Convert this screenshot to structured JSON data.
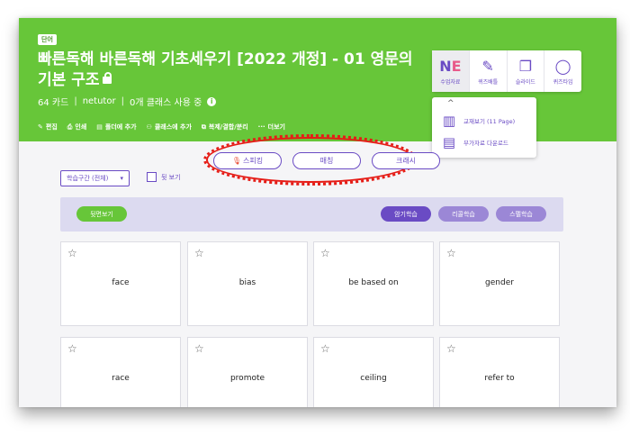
{
  "header": {
    "tag": "단어",
    "title": "빠른독해 바른독해 기초세우기 [2022 개정] - 01 영문의 기본 구조",
    "card_count": "64 카드",
    "author": "netutor",
    "class_usage": "0개 클래스 사용 중",
    "separator": "|"
  },
  "tools": [
    {
      "icon": "✎",
      "label": "편집"
    },
    {
      "icon": "⎙",
      "label": "인쇄"
    },
    {
      "icon": "▤",
      "label": "폴더에 추가"
    },
    {
      "icon": "⚇",
      "label": "클래스에 추가"
    },
    {
      "icon": "⧉",
      "label": "복제/결합/분리"
    },
    {
      "icon": "···",
      "label": "더보기"
    }
  ],
  "modes": [
    {
      "label": "수업자료",
      "icon": "nf-logo"
    },
    {
      "label": "퀴즈배틀",
      "icon": "pen-icon"
    },
    {
      "label": "슬라이드",
      "icon": "slides-icon"
    },
    {
      "label": "퀴즈타임",
      "icon": "quiz-icon"
    }
  ],
  "dropdown": {
    "items": [
      {
        "label": "교재보기 (11 Page)",
        "icon": "book-icon"
      },
      {
        "label": "부가자료 다운로드",
        "icon": "file-icon"
      }
    ]
  },
  "study_modes": [
    "스피킹",
    "매칭",
    "크래시"
  ],
  "filter": {
    "value": "학습구간 (전체)",
    "back_label": "뒷 보기"
  },
  "toolbar": {
    "flip_label": "뒷면보기",
    "buttons": [
      "암기학습",
      "리콜학습",
      "스펠학습"
    ]
  },
  "cards": [
    "face",
    "bias",
    "be based on",
    "gender",
    "race",
    "promote",
    "ceiling",
    "refer to"
  ],
  "colors": {
    "brand_green": "#67c639",
    "accent_purple": "#6a4bc4",
    "annotation_red": "#e51c16"
  }
}
